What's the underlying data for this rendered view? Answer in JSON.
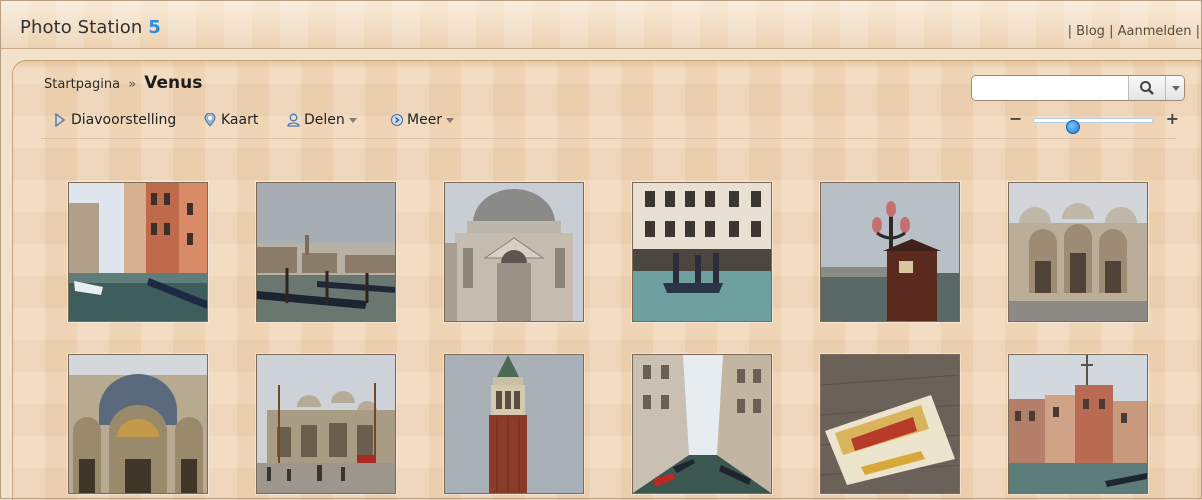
{
  "header": {
    "app_name": "Photo Station ",
    "app_version": "5",
    "sep1": "|",
    "blog_link": "Blog",
    "sep2": "|",
    "login_link": "Aanmelden",
    "sep3": "|"
  },
  "breadcrumb": {
    "home": "Startpagina",
    "separator": "»",
    "current": "Venus"
  },
  "toolbar": {
    "slideshow": "Diavoorstelling",
    "map": "Kaart",
    "share": "Delen",
    "more": "Meer"
  },
  "search": {
    "value": "",
    "placeholder": ""
  },
  "zoom": {
    "minus": "−",
    "plus": "+",
    "level": 0.32
  },
  "colors": {
    "accent": "#2a8fe0",
    "background": "#efd5b6"
  },
  "photos": [
    "canal-street",
    "canal-gondolas",
    "santa-maria-della-salute",
    "flooded-square",
    "lamp-post-kiosk",
    "basilica-facade",
    "basilica-arches",
    "piazza-san-marco",
    "campanile-tower",
    "narrow-canal",
    "casino-sign",
    "grand-canal-buildings"
  ]
}
